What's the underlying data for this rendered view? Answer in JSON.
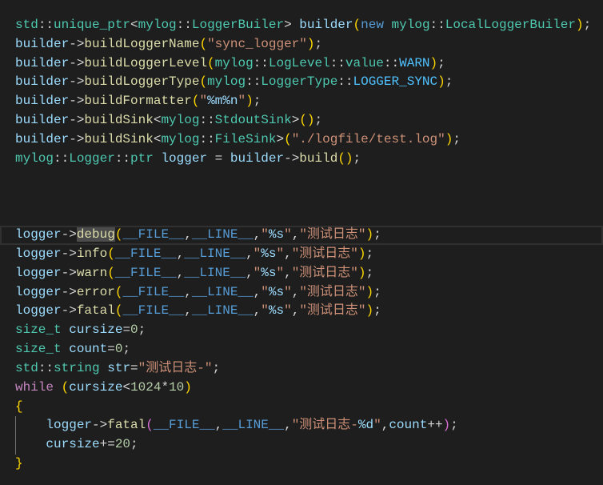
{
  "theme": {
    "background": "#1e1e1e",
    "colors": {
      "plain": "#d4d4d4",
      "variable": "#9cdcfe",
      "function": "#dcdcaa",
      "type": "#4ec9b0",
      "keyword": "#569cd6",
      "control": "#c586c0",
      "string": "#ce9178",
      "format": "#9cdcfe",
      "enum": "#4fc1ff",
      "macro": "#569cd6",
      "number": "#b5cea8",
      "bracket1": "#ffd700",
      "bracket2": "#da70d6",
      "indent_guide": "#707070",
      "active_line_border": "#303030",
      "word_highlight": "#4b4b4b"
    }
  },
  "editor": {
    "lines": [
      {
        "tokens": [
          [
            "std",
            "type"
          ],
          [
            "::",
            "plain"
          ],
          [
            "unique_ptr",
            "type"
          ],
          [
            "<",
            "plain"
          ],
          [
            "mylog",
            "type"
          ],
          [
            "::",
            "plain"
          ],
          [
            "LoggerBuiler",
            "type"
          ],
          [
            "> ",
            "plain"
          ],
          [
            "builder",
            "variable"
          ],
          [
            "(",
            "bracket1"
          ],
          [
            "new",
            "keyword"
          ],
          [
            " ",
            "plain"
          ],
          [
            "mylog",
            "type"
          ],
          [
            "::",
            "plain"
          ],
          [
            "LocalLoggerBuiler",
            "type"
          ],
          [
            ")",
            "bracket1"
          ],
          [
            ";",
            "plain"
          ]
        ]
      },
      {
        "tokens": [
          [
            "builder",
            "variable"
          ],
          [
            "->",
            "plain"
          ],
          [
            "buildLoggerName",
            "function"
          ],
          [
            "(",
            "bracket1"
          ],
          [
            "\"sync_logger\"",
            "string"
          ],
          [
            ")",
            "bracket1"
          ],
          [
            ";",
            "plain"
          ]
        ]
      },
      {
        "tokens": [
          [
            "builder",
            "variable"
          ],
          [
            "->",
            "plain"
          ],
          [
            "buildLoggerLevel",
            "function"
          ],
          [
            "(",
            "bracket1"
          ],
          [
            "mylog",
            "type"
          ],
          [
            "::",
            "plain"
          ],
          [
            "LogLevel",
            "type"
          ],
          [
            "::",
            "plain"
          ],
          [
            "value",
            "type"
          ],
          [
            "::",
            "plain"
          ],
          [
            "WARN",
            "enum"
          ],
          [
            ")",
            "bracket1"
          ],
          [
            ";",
            "plain"
          ]
        ]
      },
      {
        "tokens": [
          [
            "builder",
            "variable"
          ],
          [
            "->",
            "plain"
          ],
          [
            "buildLoggerType",
            "function"
          ],
          [
            "(",
            "bracket1"
          ],
          [
            "mylog",
            "type"
          ],
          [
            "::",
            "plain"
          ],
          [
            "LoggerType",
            "type"
          ],
          [
            "::",
            "plain"
          ],
          [
            "LOGGER_SYNC",
            "enum"
          ],
          [
            ")",
            "bracket1"
          ],
          [
            ";",
            "plain"
          ]
        ]
      },
      {
        "tokens": [
          [
            "builder",
            "variable"
          ],
          [
            "->",
            "plain"
          ],
          [
            "buildFormatter",
            "function"
          ],
          [
            "(",
            "bracket1"
          ],
          [
            "\"",
            "string"
          ],
          [
            "%m%n",
            "format"
          ],
          [
            "\"",
            "string"
          ],
          [
            ")",
            "bracket1"
          ],
          [
            ";",
            "plain"
          ]
        ]
      },
      {
        "tokens": [
          [
            "builder",
            "variable"
          ],
          [
            "->",
            "plain"
          ],
          [
            "buildSink",
            "function"
          ],
          [
            "<",
            "plain"
          ],
          [
            "mylog",
            "type"
          ],
          [
            "::",
            "plain"
          ],
          [
            "StdoutSink",
            "type"
          ],
          [
            ">",
            "plain"
          ],
          [
            "()",
            "bracket1"
          ],
          [
            ";",
            "plain"
          ]
        ]
      },
      {
        "tokens": [
          [
            "builder",
            "variable"
          ],
          [
            "->",
            "plain"
          ],
          [
            "buildSink",
            "function"
          ],
          [
            "<",
            "plain"
          ],
          [
            "mylog",
            "type"
          ],
          [
            "::",
            "plain"
          ],
          [
            "FileSink",
            "type"
          ],
          [
            ">",
            "plain"
          ],
          [
            "(",
            "bracket1"
          ],
          [
            "\"./logfile/test.log\"",
            "string"
          ],
          [
            ")",
            "bracket1"
          ],
          [
            ";",
            "plain"
          ]
        ]
      },
      {
        "tokens": [
          [
            "mylog",
            "type"
          ],
          [
            "::",
            "plain"
          ],
          [
            "Logger",
            "type"
          ],
          [
            "::",
            "plain"
          ],
          [
            "ptr",
            "type"
          ],
          [
            " ",
            "plain"
          ],
          [
            "logger",
            "variable"
          ],
          [
            " = ",
            "plain"
          ],
          [
            "builder",
            "variable"
          ],
          [
            "->",
            "plain"
          ],
          [
            "build",
            "function"
          ],
          [
            "()",
            "bracket1"
          ],
          [
            ";",
            "plain"
          ]
        ]
      },
      {
        "tokens": []
      },
      {
        "tokens": []
      },
      {
        "tokens": []
      },
      {
        "active": true,
        "tokens": [
          [
            "logger",
            "variable"
          ],
          [
            "->",
            "plain"
          ],
          [
            "debug",
            "function",
            true
          ],
          [
            "(",
            "bracket1"
          ],
          [
            "__FILE__",
            "macro"
          ],
          [
            ",",
            "plain"
          ],
          [
            "__LINE__",
            "macro"
          ],
          [
            ",",
            "plain"
          ],
          [
            "\"",
            "string"
          ],
          [
            "%s",
            "format"
          ],
          [
            "\"",
            "string"
          ],
          [
            ",",
            "plain"
          ],
          [
            "\"测试日志\"",
            "string"
          ],
          [
            ")",
            "bracket1"
          ],
          [
            ";",
            "plain"
          ]
        ]
      },
      {
        "tokens": [
          [
            "logger",
            "variable"
          ],
          [
            "->",
            "plain"
          ],
          [
            "info",
            "function"
          ],
          [
            "(",
            "bracket1"
          ],
          [
            "__FILE__",
            "macro"
          ],
          [
            ",",
            "plain"
          ],
          [
            "__LINE__",
            "macro"
          ],
          [
            ",",
            "plain"
          ],
          [
            "\"",
            "string"
          ],
          [
            "%s",
            "format"
          ],
          [
            "\"",
            "string"
          ],
          [
            ",",
            "plain"
          ],
          [
            "\"测试日志\"",
            "string"
          ],
          [
            ")",
            "bracket1"
          ],
          [
            ";",
            "plain"
          ]
        ]
      },
      {
        "tokens": [
          [
            "logger",
            "variable"
          ],
          [
            "->",
            "plain"
          ],
          [
            "warn",
            "function"
          ],
          [
            "(",
            "bracket1"
          ],
          [
            "__FILE__",
            "macro"
          ],
          [
            ",",
            "plain"
          ],
          [
            "__LINE__",
            "macro"
          ],
          [
            ",",
            "plain"
          ],
          [
            "\"",
            "string"
          ],
          [
            "%s",
            "format"
          ],
          [
            "\"",
            "string"
          ],
          [
            ",",
            "plain"
          ],
          [
            "\"测试日志\"",
            "string"
          ],
          [
            ")",
            "bracket1"
          ],
          [
            ";",
            "plain"
          ]
        ]
      },
      {
        "tokens": [
          [
            "logger",
            "variable"
          ],
          [
            "->",
            "plain"
          ],
          [
            "error",
            "function"
          ],
          [
            "(",
            "bracket1"
          ],
          [
            "__FILE__",
            "macro"
          ],
          [
            ",",
            "plain"
          ],
          [
            "__LINE__",
            "macro"
          ],
          [
            ",",
            "plain"
          ],
          [
            "\"",
            "string"
          ],
          [
            "%s",
            "format"
          ],
          [
            "\"",
            "string"
          ],
          [
            ",",
            "plain"
          ],
          [
            "\"测试日志\"",
            "string"
          ],
          [
            ")",
            "bracket1"
          ],
          [
            ";",
            "plain"
          ]
        ]
      },
      {
        "tokens": [
          [
            "logger",
            "variable"
          ],
          [
            "->",
            "plain"
          ],
          [
            "fatal",
            "function"
          ],
          [
            "(",
            "bracket1"
          ],
          [
            "__FILE__",
            "macro"
          ],
          [
            ",",
            "plain"
          ],
          [
            "__LINE__",
            "macro"
          ],
          [
            ",",
            "plain"
          ],
          [
            "\"",
            "string"
          ],
          [
            "%s",
            "format"
          ],
          [
            "\"",
            "string"
          ],
          [
            ",",
            "plain"
          ],
          [
            "\"测试日志\"",
            "string"
          ],
          [
            ")",
            "bracket1"
          ],
          [
            ";",
            "plain"
          ]
        ]
      },
      {
        "tokens": [
          [
            "size_t",
            "type"
          ],
          [
            " ",
            "plain"
          ],
          [
            "cursize",
            "variable"
          ],
          [
            "=",
            "plain"
          ],
          [
            "0",
            "number"
          ],
          [
            ";",
            "plain"
          ]
        ]
      },
      {
        "tokens": [
          [
            "size_t",
            "type"
          ],
          [
            " ",
            "plain"
          ],
          [
            "count",
            "variable"
          ],
          [
            "=",
            "plain"
          ],
          [
            "0",
            "number"
          ],
          [
            ";",
            "plain"
          ]
        ]
      },
      {
        "tokens": [
          [
            "std",
            "type"
          ],
          [
            "::",
            "plain"
          ],
          [
            "string",
            "type"
          ],
          [
            " ",
            "plain"
          ],
          [
            "str",
            "variable"
          ],
          [
            "=",
            "plain"
          ],
          [
            "\"测试日志-\"",
            "string"
          ],
          [
            ";",
            "plain"
          ]
        ]
      },
      {
        "tokens": [
          [
            "while",
            "control"
          ],
          [
            " ",
            "plain"
          ],
          [
            "(",
            "bracket1"
          ],
          [
            "cursize",
            "variable"
          ],
          [
            "<",
            "plain"
          ],
          [
            "1024",
            "number"
          ],
          [
            "*",
            "plain"
          ],
          [
            "10",
            "number"
          ],
          [
            ")",
            "bracket1"
          ]
        ]
      },
      {
        "tokens": [
          [
            "{",
            "bracket1"
          ]
        ]
      },
      {
        "tokens": [
          [
            "    ",
            "plain"
          ],
          [
            "logger",
            "variable"
          ],
          [
            "->",
            "plain"
          ],
          [
            "fatal",
            "function"
          ],
          [
            "(",
            "bracket2"
          ],
          [
            "__FILE__",
            "macro"
          ],
          [
            ",",
            "plain"
          ],
          [
            "__LINE__",
            "macro"
          ],
          [
            ",",
            "plain"
          ],
          [
            "\"测试日志-",
            "string"
          ],
          [
            "%d",
            "format"
          ],
          [
            "\"",
            "string"
          ],
          [
            ",",
            "plain"
          ],
          [
            "count",
            "variable"
          ],
          [
            "++",
            "plain"
          ],
          [
            ")",
            "bracket2"
          ],
          [
            ";",
            "plain"
          ]
        ]
      },
      {
        "tokens": [
          [
            "    ",
            "plain"
          ],
          [
            "cursize",
            "variable"
          ],
          [
            "+=",
            "plain"
          ],
          [
            "20",
            "number"
          ],
          [
            ";",
            "plain"
          ]
        ]
      },
      {
        "tokens": [
          [
            "}",
            "bracket1"
          ]
        ]
      }
    ]
  }
}
